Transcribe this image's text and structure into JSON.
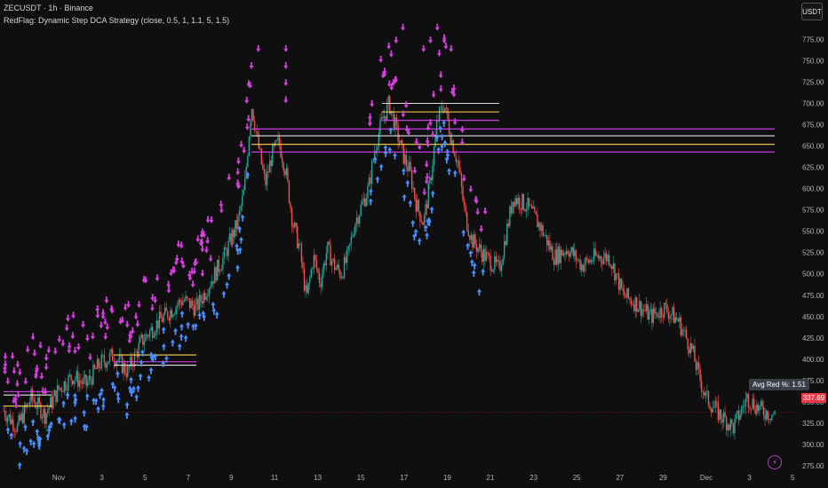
{
  "header": {
    "symbol_line": "ZECUSDT · 1h · Binance",
    "indicator_line": "RedFlag: Dynamic Step DCA Strategy (close, 0.5, 1, 1.1, 5, 1.5)"
  },
  "currency_button": "USDT",
  "y_axis": {
    "labels": [
      "775.00",
      "750.00",
      "725.00",
      "700.00",
      "675.00",
      "650.00",
      "625.00",
      "600.00",
      "575.00",
      "550.00",
      "525.00",
      "500.00",
      "475.00",
      "450.00",
      "425.00",
      "400.00",
      "375.00",
      "350.00",
      "325.00",
      "300.00",
      "275.00"
    ]
  },
  "x_axis": {
    "labels": [
      "Nov",
      "3",
      "5",
      "7",
      "9",
      "11",
      "13",
      "15",
      "17",
      "19",
      "21",
      "23",
      "25",
      "27",
      "29",
      "Dec",
      "3",
      "5"
    ]
  },
  "last_price": "337.69",
  "avg_label": "Avg Red %: 1.51",
  "colors": {
    "background": "#0f0f0f",
    "up": "#26a69a",
    "down": "#ef5350",
    "sell_marker": "#d63fe0",
    "buy_marker": "#4a8fff",
    "level_magenta": "#e040fb",
    "level_white": "#e0e0e0",
    "level_yellow": "#ffd54f",
    "last_price": "#f23645"
  },
  "icons": {
    "flash": "flash-icon"
  },
  "chart_data": {
    "type": "candlestick",
    "ylim": [
      275,
      790
    ],
    "price_path": [
      [
        0,
        340
      ],
      [
        2,
        320
      ],
      [
        4,
        355
      ],
      [
        6,
        335
      ],
      [
        8,
        365
      ],
      [
        10,
        380
      ],
      [
        12,
        370
      ],
      [
        14,
        395
      ],
      [
        16,
        405
      ],
      [
        18,
        385
      ],
      [
        20,
        420
      ],
      [
        22,
        440
      ],
      [
        24,
        455
      ],
      [
        26,
        470
      ],
      [
        28,
        460
      ],
      [
        30,
        490
      ],
      [
        32,
        520
      ],
      [
        34,
        560
      ],
      [
        35,
        600
      ],
      [
        36,
        700
      ],
      [
        37,
        650
      ],
      [
        38,
        605
      ],
      [
        39,
        640
      ],
      [
        40,
        655
      ],
      [
        41,
        620
      ],
      [
        42,
        560
      ],
      [
        43,
        530
      ],
      [
        44,
        470
      ],
      [
        45,
        520
      ],
      [
        46,
        490
      ],
      [
        47,
        530
      ],
      [
        48,
        510
      ],
      [
        49,
        500
      ],
      [
        50,
        520
      ],
      [
        51,
        560
      ],
      [
        52,
        580
      ],
      [
        53,
        600
      ],
      [
        54,
        650
      ],
      [
        55,
        680
      ],
      [
        56,
        700
      ],
      [
        57,
        670
      ],
      [
        58,
        640
      ],
      [
        59,
        620
      ],
      [
        60,
        580
      ],
      [
        61,
        560
      ],
      [
        62,
        610
      ],
      [
        63,
        680
      ],
      [
        64,
        700
      ],
      [
        65,
        660
      ],
      [
        66,
        630
      ],
      [
        67,
        570
      ],
      [
        68,
        540
      ],
      [
        70,
        520
      ],
      [
        72,
        505
      ],
      [
        74,
        590
      ],
      [
        76,
        580
      ],
      [
        78,
        555
      ],
      [
        80,
        520
      ],
      [
        82,
        530
      ],
      [
        84,
        510
      ],
      [
        86,
        520
      ],
      [
        88,
        520
      ],
      [
        90,
        475
      ],
      [
        92,
        465
      ],
      [
        94,
        450
      ],
      [
        96,
        460
      ],
      [
        98,
        445
      ],
      [
        100,
        410
      ],
      [
        101,
        380
      ],
      [
        102,
        355
      ],
      [
        104,
        335
      ],
      [
        106,
        320
      ],
      [
        108,
        355
      ],
      [
        110,
        340
      ],
      [
        112,
        335
      ]
    ],
    "levels": [
      {
        "price": 362,
        "x_range": [
          0,
          7
        ]
      },
      {
        "price": 358,
        "x_range": [
          0,
          7
        ]
      },
      {
        "price": 345,
        "x_range": [
          0,
          7
        ]
      },
      {
        "price": 397,
        "x_range": [
          16,
          28
        ]
      },
      {
        "price": 393,
        "x_range": [
          16,
          28
        ]
      },
      {
        "price": 405,
        "x_range": [
          16,
          28
        ]
      },
      {
        "price": 670,
        "x_range": [
          36,
          112
        ]
      },
      {
        "price": 662,
        "x_range": [
          36,
          112
        ]
      },
      {
        "price": 652,
        "x_range": [
          36,
          112
        ]
      },
      {
        "price": 643,
        "x_range": [
          36,
          112
        ]
      },
      {
        "price": 700,
        "x_range": [
          55,
          72
        ]
      },
      {
        "price": 690,
        "x_range": [
          55,
          72
        ]
      },
      {
        "price": 680,
        "x_range": [
          55,
          72
        ]
      }
    ]
  }
}
